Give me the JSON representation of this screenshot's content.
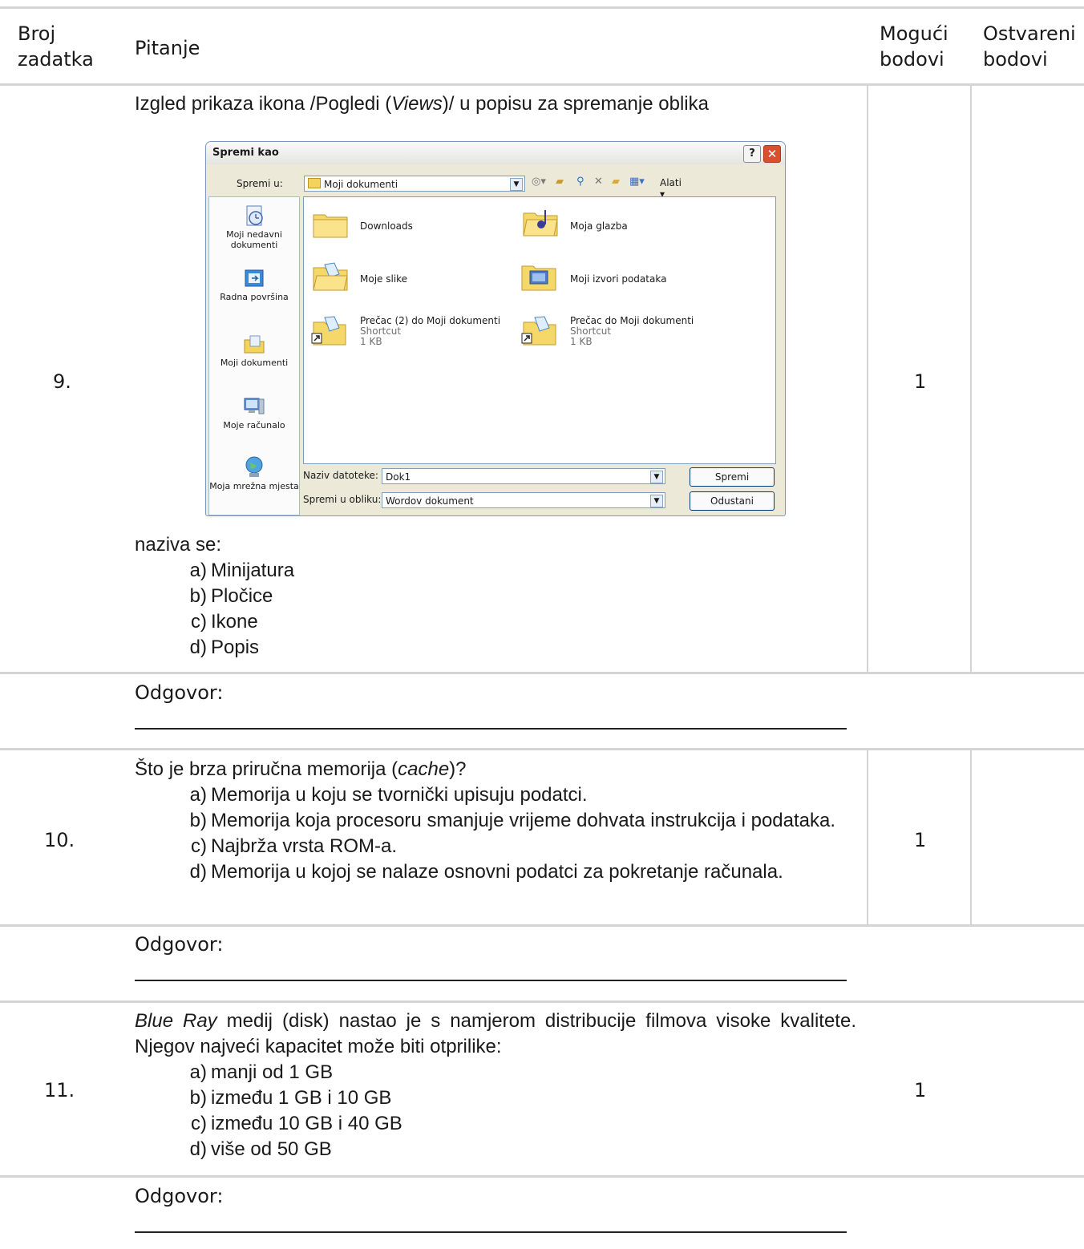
{
  "header": {
    "col_num": "Broj zadatka",
    "col_num_l1": "Broj",
    "col_num_l2": "zadatka",
    "col_question": "Pitanje",
    "col_possible_l1": "Mogući",
    "col_possible_l2": "bodovi",
    "col_earned_l1": "Ostvareni",
    "col_earned_l2": "bodovi"
  },
  "q9": {
    "number": "9.",
    "text_pre": "Izgled prikaza ikona /Pogledi (",
    "text_em": "Views",
    "text_post": ")/ u popisu za spremanje oblika",
    "after": "naziva se:",
    "options": [
      {
        "letter": "a)",
        "text": "Minijatura"
      },
      {
        "letter": "b)",
        "text": "Pločice"
      },
      {
        "letter": "c)",
        "text": "Ikone"
      },
      {
        "letter": "d)",
        "text": "Popis"
      }
    ],
    "points": "1",
    "answer_label": "Odgovor:"
  },
  "dialog": {
    "title": "Spremi kao",
    "help": "?",
    "close": "✕",
    "save_in_label": "Spremi u:",
    "save_in_value": "Moji dokumenti",
    "tools_label": "Alati ▾",
    "places": [
      "Moji nedavni dokumenti",
      "Radna površina",
      "Moji dokumenti",
      "Moje računalo",
      "Moja mrežna mjesta"
    ],
    "items": [
      {
        "name": "Downloads"
      },
      {
        "name": "Moja glazba"
      },
      {
        "name": "Moje slike"
      },
      {
        "name": "Moji izvori podataka"
      },
      {
        "name": "Prečac (2) do Moji dokumenti",
        "type": "Shortcut",
        "size": "1 KB"
      },
      {
        "name": "Prečac do Moji dokumenti",
        "type": "Shortcut",
        "size": "1 KB"
      }
    ],
    "filename_label": "Naziv datoteke:",
    "filename_value": "Dok1",
    "format_label": "Spremi u obliku:",
    "format_value": "Wordov dokument",
    "save_button": "Spremi",
    "cancel_button": "Odustani"
  },
  "q10": {
    "number": "10.",
    "text_pre": "Što je brza priručna memorija (",
    "text_em": "cache",
    "text_post": ")?",
    "options": [
      {
        "letter": "a)",
        "text": "Memorija u koju se tvornički upisuju podatci."
      },
      {
        "letter": "b)",
        "text": "Memorija koja procesoru smanjuje vrijeme dohvata instrukcija i podataka."
      },
      {
        "letter": "c)",
        "text": "Najbrža vrsta ROM-a."
      },
      {
        "letter": "d)",
        "text": "Memorija u kojoj se nalaze osnovni podatci za pokretanje računala."
      }
    ],
    "points": "1",
    "answer_label": "Odgovor:"
  },
  "q11": {
    "number": "11.",
    "text_em": "Blue Ray",
    "text_post": " medij (disk) nastao je s namjerom distribucije filmova visoke kvalitete. Njegov najveći kapacitet može biti otprilike:",
    "options": [
      {
        "letter": "a)",
        "text": "manji od 1 GB"
      },
      {
        "letter": "b)",
        "text": "između 1 GB i 10 GB"
      },
      {
        "letter": "c)",
        "text": "između 10 GB i 40 GB"
      },
      {
        "letter": "d)",
        "text": "više od 50 GB"
      }
    ],
    "points": "1",
    "answer_label": "Odgovor:"
  }
}
